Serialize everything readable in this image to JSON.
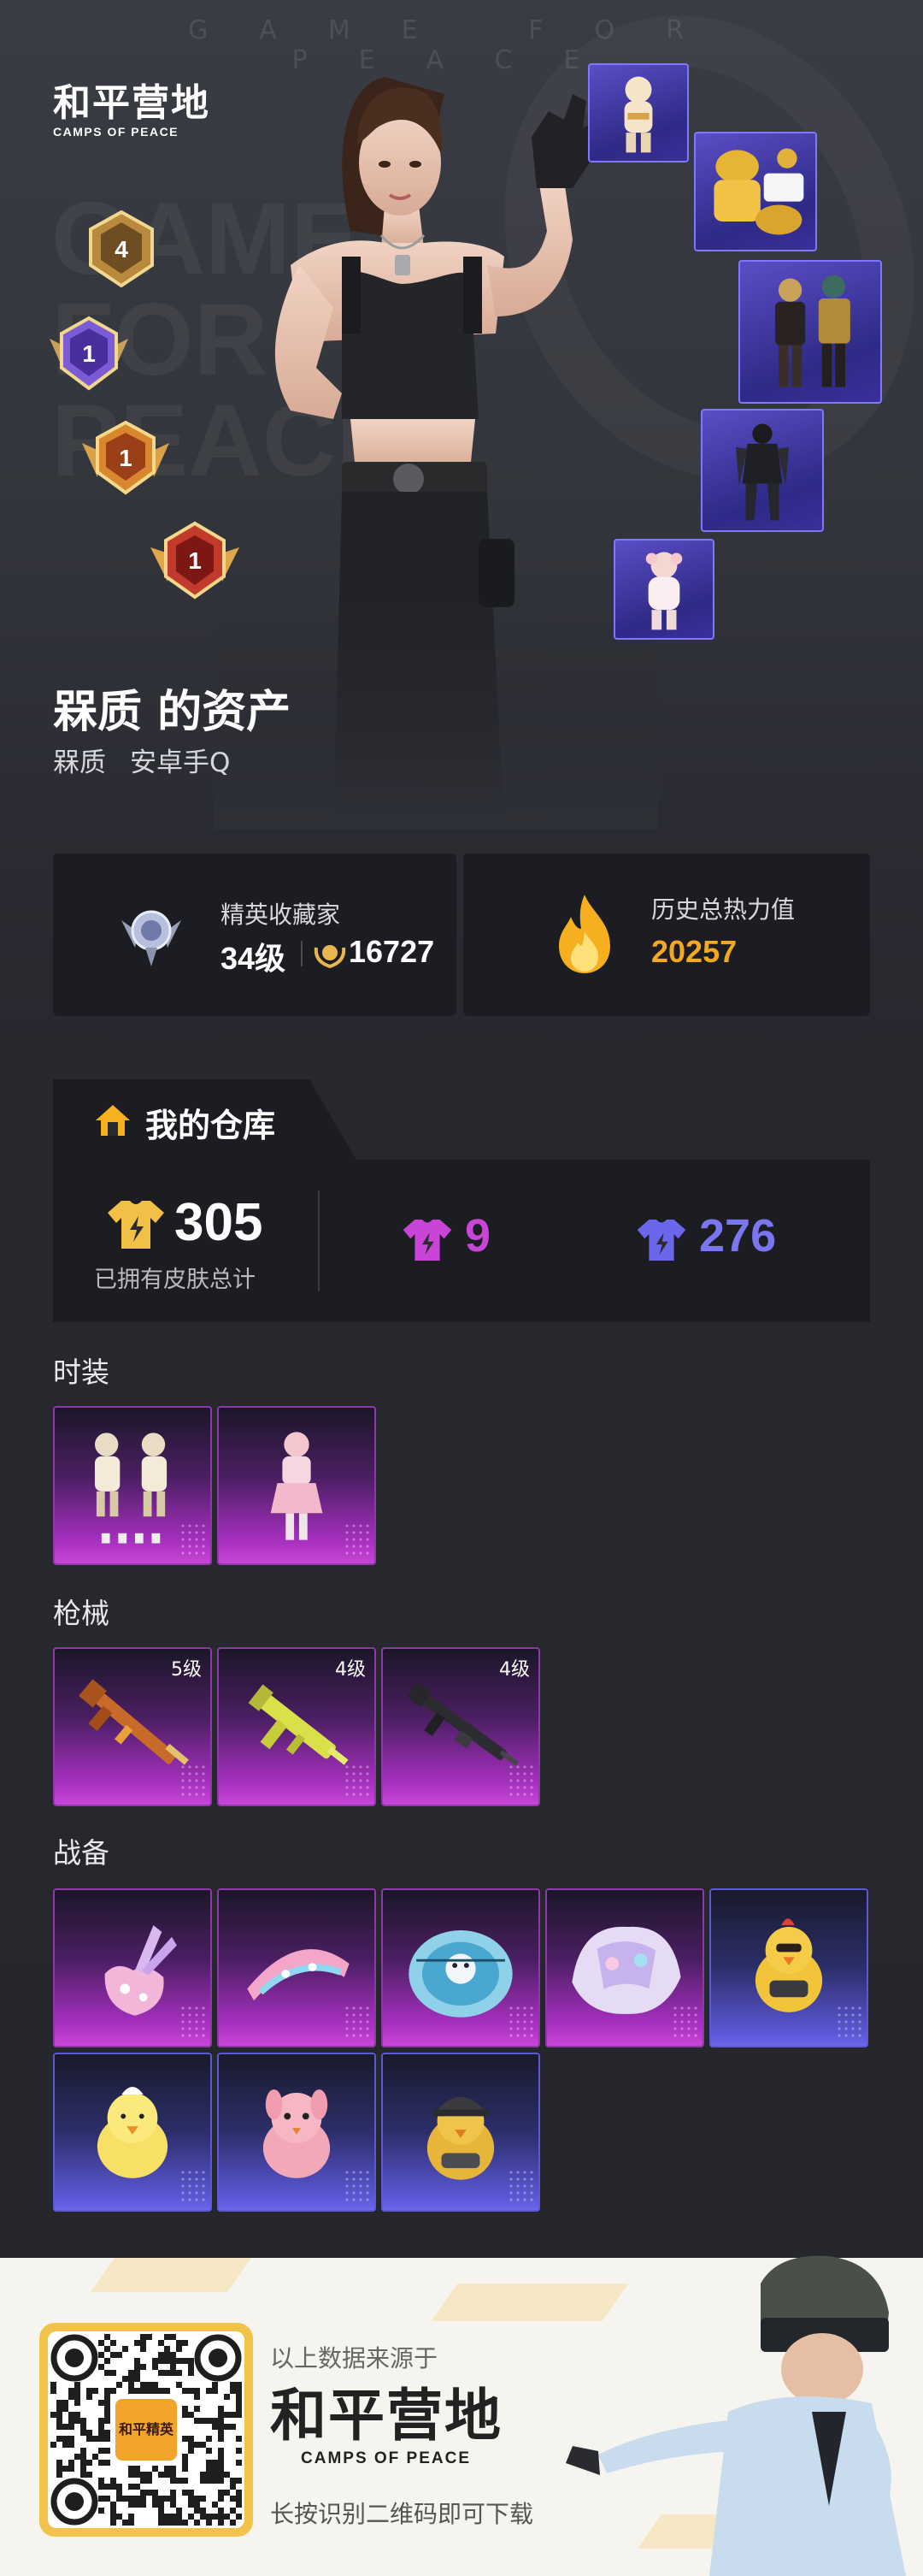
{
  "header": {
    "slogan": "GAME FOR PEACE",
    "logo_main": "和平营地",
    "logo_sub": "CAMPS OF PEACE",
    "bg_text": [
      "GAME",
      "FOR",
      "PEACE"
    ]
  },
  "badges": [
    {
      "level": "4",
      "color": "#b98a3e",
      "icon": "rank-badge-icon"
    },
    {
      "level": "1",
      "color": "#7b5bd6",
      "icon": "rank-badge-icon"
    },
    {
      "level": "1",
      "color": "#d9872f",
      "icon": "rank-badge-icon"
    },
    {
      "level": "1",
      "color": "#c23a2c",
      "icon": "rank-badge-icon"
    }
  ],
  "owner": {
    "title": "槑质 的资产",
    "name": "槑质",
    "platform": "安卓手Q"
  },
  "stats": {
    "collector_label": "精英收藏家",
    "collector_level": "34级",
    "collector_points": "16727",
    "heat_label": "历史总热力值",
    "heat_value": "20257"
  },
  "warehouse": {
    "title": "我的仓库",
    "total_skins": "305",
    "total_caption": "已拥有皮肤总计",
    "purple_count": "9",
    "blue_count": "276"
  },
  "sections": {
    "fashion": "时装",
    "weapons": "枪械",
    "equipment": "战备"
  },
  "weapon_levels": [
    "5级",
    "4级",
    "4级"
  ],
  "colors": {
    "gold": "#f2c046",
    "purple_tier": "#c845d7",
    "blue_tier": "#6b67ea",
    "heat": "#f3a91f"
  },
  "footer": {
    "source_text": "以上数据来源于",
    "logo_main": "和平营地",
    "logo_sub": "CAMPS OF PEACE",
    "download_text": "长按识别二维码即可下载",
    "qr_center_label": "和平精英"
  }
}
